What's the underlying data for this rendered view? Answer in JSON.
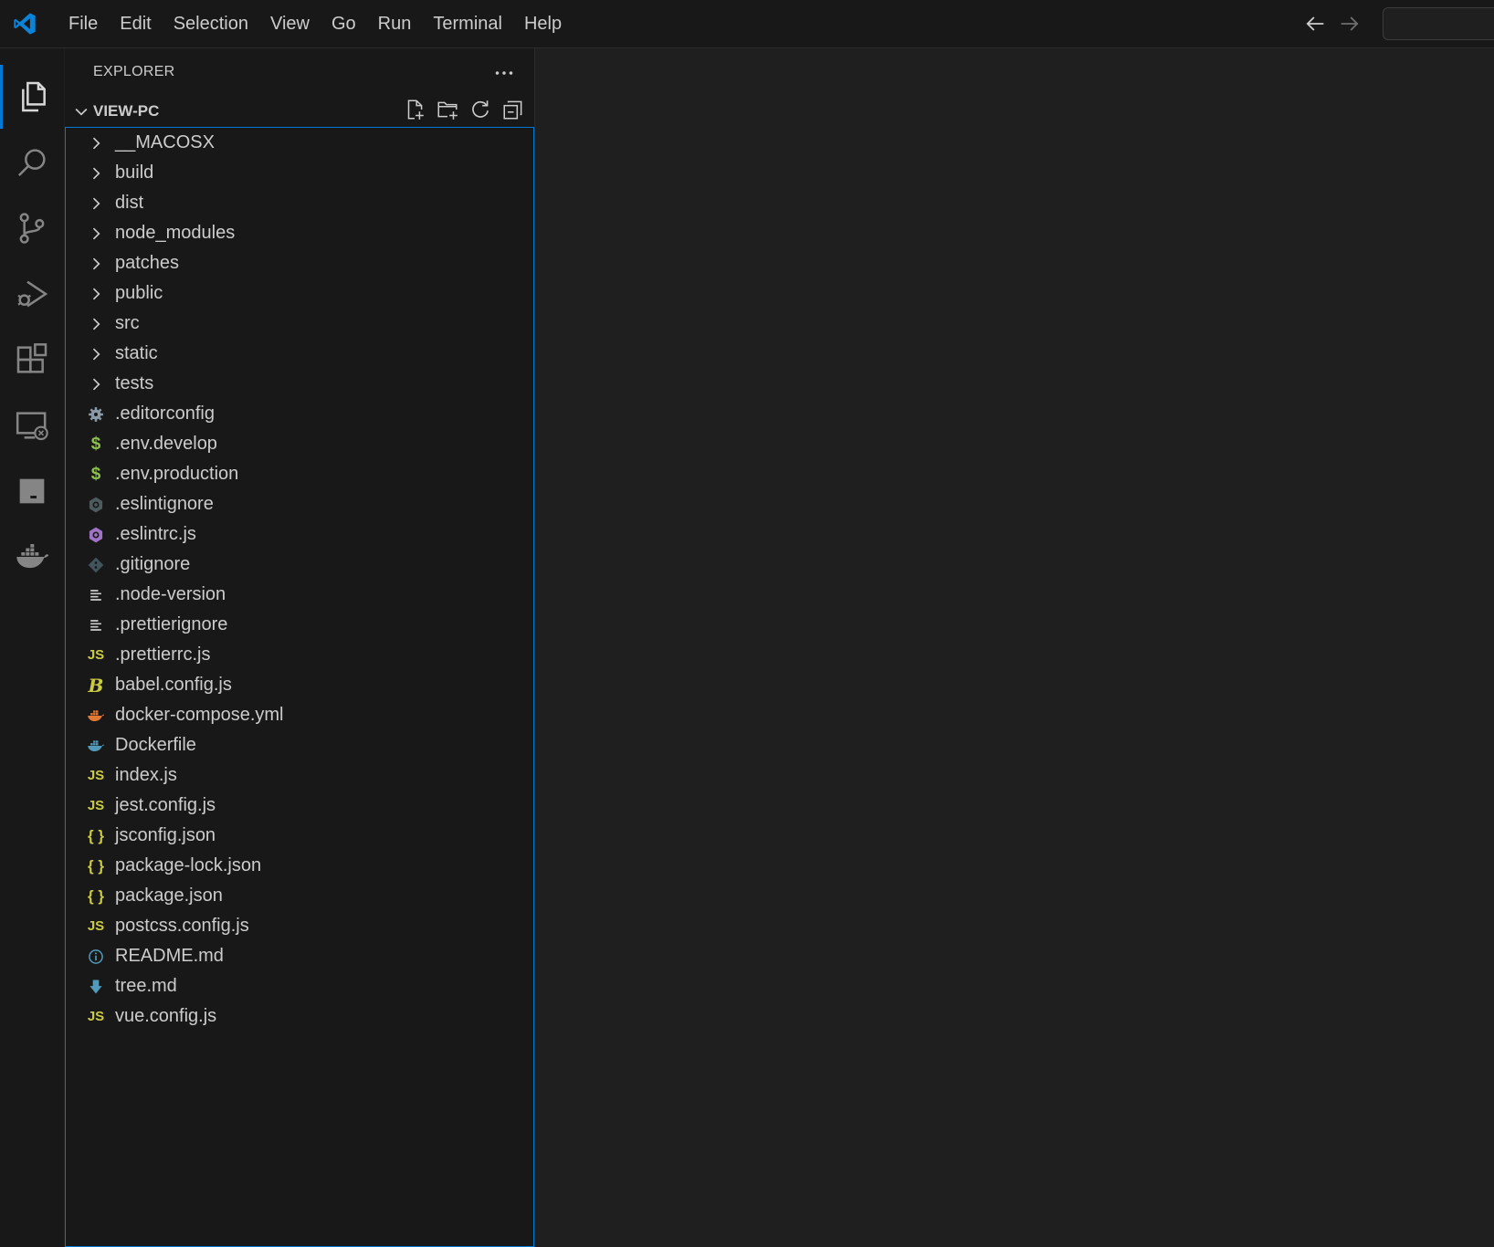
{
  "menu": [
    "File",
    "Edit",
    "Selection",
    "View",
    "Go",
    "Run",
    "Terminal",
    "Help"
  ],
  "explorer": {
    "header": "EXPLORER",
    "folder": "VIEW-PC",
    "items": [
      {
        "name": "__MACOSX",
        "kind": "folder",
        "icon": "chevron-right-icon"
      },
      {
        "name": "build",
        "kind": "folder",
        "icon": "chevron-right-icon"
      },
      {
        "name": "dist",
        "kind": "folder",
        "icon": "chevron-right-icon"
      },
      {
        "name": "node_modules",
        "kind": "folder",
        "icon": "chevron-right-icon"
      },
      {
        "name": "patches",
        "kind": "folder",
        "icon": "chevron-right-icon"
      },
      {
        "name": "public",
        "kind": "folder",
        "icon": "chevron-right-icon"
      },
      {
        "name": "src",
        "kind": "folder",
        "icon": "chevron-right-icon"
      },
      {
        "name": "static",
        "kind": "folder",
        "icon": "chevron-right-icon"
      },
      {
        "name": "tests",
        "kind": "folder",
        "icon": "chevron-right-icon"
      },
      {
        "name": ".editorconfig",
        "kind": "file",
        "icon": "gear-icon",
        "color": "#8a9aa8"
      },
      {
        "name": ".env.develop",
        "kind": "file",
        "icon": "dollar-icon",
        "color": "#8dc149"
      },
      {
        "name": ".env.production",
        "kind": "file",
        "icon": "dollar-icon",
        "color": "#8dc149"
      },
      {
        "name": ".eslintignore",
        "kind": "file",
        "icon": "eslint-icon",
        "color": "#4d5a5e"
      },
      {
        "name": ".eslintrc.js",
        "kind": "file",
        "icon": "eslint-icon",
        "color": "#a074c4"
      },
      {
        "name": ".gitignore",
        "kind": "file",
        "icon": "git-icon",
        "color": "#41535b"
      },
      {
        "name": ".node-version",
        "kind": "file",
        "icon": "lines-icon",
        "color": "#cccccc"
      },
      {
        "name": ".prettierignore",
        "kind": "file",
        "icon": "lines-icon",
        "color": "#cccccc"
      },
      {
        "name": ".prettierrc.js",
        "kind": "file",
        "icon": "js-icon",
        "color": "#cbcb41"
      },
      {
        "name": "babel.config.js",
        "kind": "file",
        "icon": "babel-icon",
        "color": "#cbcb41"
      },
      {
        "name": "docker-compose.yml",
        "kind": "file",
        "icon": "docker-icon",
        "color": "#e37933"
      },
      {
        "name": "Dockerfile",
        "kind": "file",
        "icon": "docker-icon",
        "color": "#519aba"
      },
      {
        "name": "index.js",
        "kind": "file",
        "icon": "js-icon",
        "color": "#cbcb41"
      },
      {
        "name": "jest.config.js",
        "kind": "file",
        "icon": "js-icon",
        "color": "#cbcb41"
      },
      {
        "name": "jsconfig.json",
        "kind": "file",
        "icon": "json-icon",
        "color": "#cbcb41"
      },
      {
        "name": "package-lock.json",
        "kind": "file",
        "icon": "json-icon",
        "color": "#cbcb41"
      },
      {
        "name": "package.json",
        "kind": "file",
        "icon": "json-icon",
        "color": "#cbcb41"
      },
      {
        "name": "postcss.config.js",
        "kind": "file",
        "icon": "js-icon",
        "color": "#cbcb41"
      },
      {
        "name": "README.md",
        "kind": "file",
        "icon": "info-icon",
        "color": "#519aba"
      },
      {
        "name": "tree.md",
        "kind": "file",
        "icon": "markdown-icon",
        "color": "#519aba"
      },
      {
        "name": "vue.config.js",
        "kind": "file",
        "icon": "js-icon",
        "color": "#cbcb41"
      }
    ]
  },
  "colors": {
    "accent": "#0078d4",
    "background": "#1f1f1f",
    "sidebar": "#181818"
  }
}
